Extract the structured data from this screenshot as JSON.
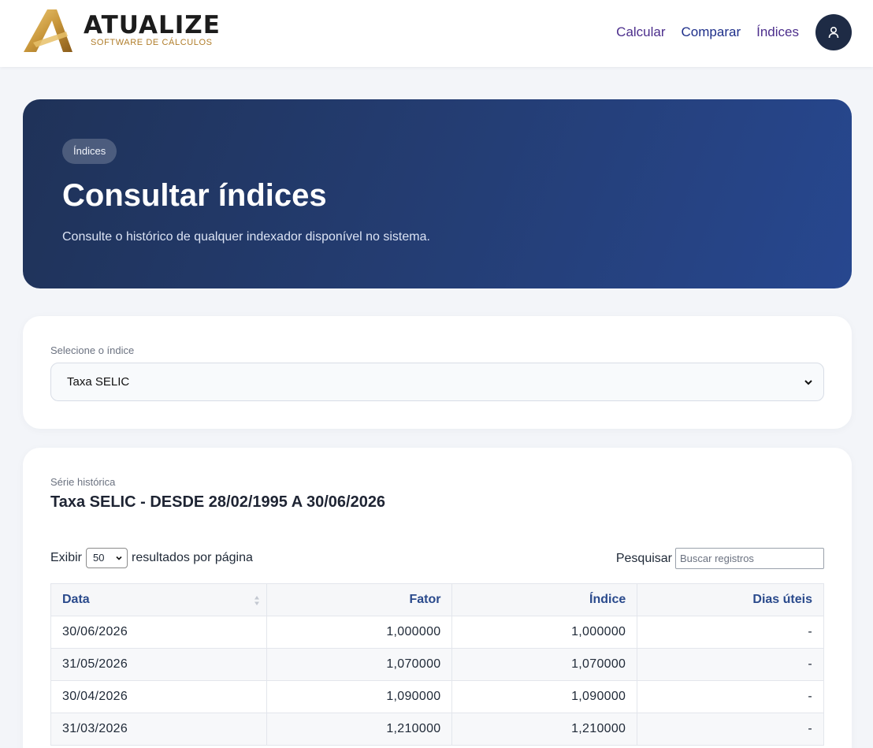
{
  "header": {
    "logo_name": "ATUALIZE",
    "logo_tagline": "SOFTWARE DE CÁLCULOS",
    "nav": [
      {
        "label": "Calcular"
      },
      {
        "label": "Comparar"
      },
      {
        "label": "Índices"
      }
    ],
    "avatar_icon": "user-icon"
  },
  "hero": {
    "badge": "Índices",
    "title": "Consultar índices",
    "subtitle": "Consulte o histórico de qualquer indexador disponível no sistema."
  },
  "selector": {
    "label": "Selecione o índice",
    "selected": "Taxa SELIC"
  },
  "table_card": {
    "overline": "Série histórica",
    "title": "Taxa SELIC - DESDE 28/02/1995 A 30/06/2026",
    "length_prefix": "Exibir",
    "length_value": "50",
    "length_suffix": "resultados por página",
    "search_label": "Pesquisar",
    "search_placeholder": "Buscar registros",
    "columns": [
      "Data",
      "Fator",
      "Índice",
      "Dias úteis"
    ],
    "rows": [
      [
        "30/06/2026",
        "1,000000",
        "1,000000",
        "-"
      ],
      [
        "31/05/2026",
        "1,070000",
        "1,070000",
        "-"
      ],
      [
        "30/04/2026",
        "1,090000",
        "1,090000",
        "-"
      ],
      [
        "31/03/2026",
        "1,210000",
        "1,210000",
        "-"
      ]
    ]
  },
  "colors": {
    "hero_start": "#1f3258",
    "hero_end": "#27478f",
    "nav_link": "#4c2e8c",
    "table_header_text": "#2a4a8c",
    "logo_gold": "#b07d2a"
  }
}
